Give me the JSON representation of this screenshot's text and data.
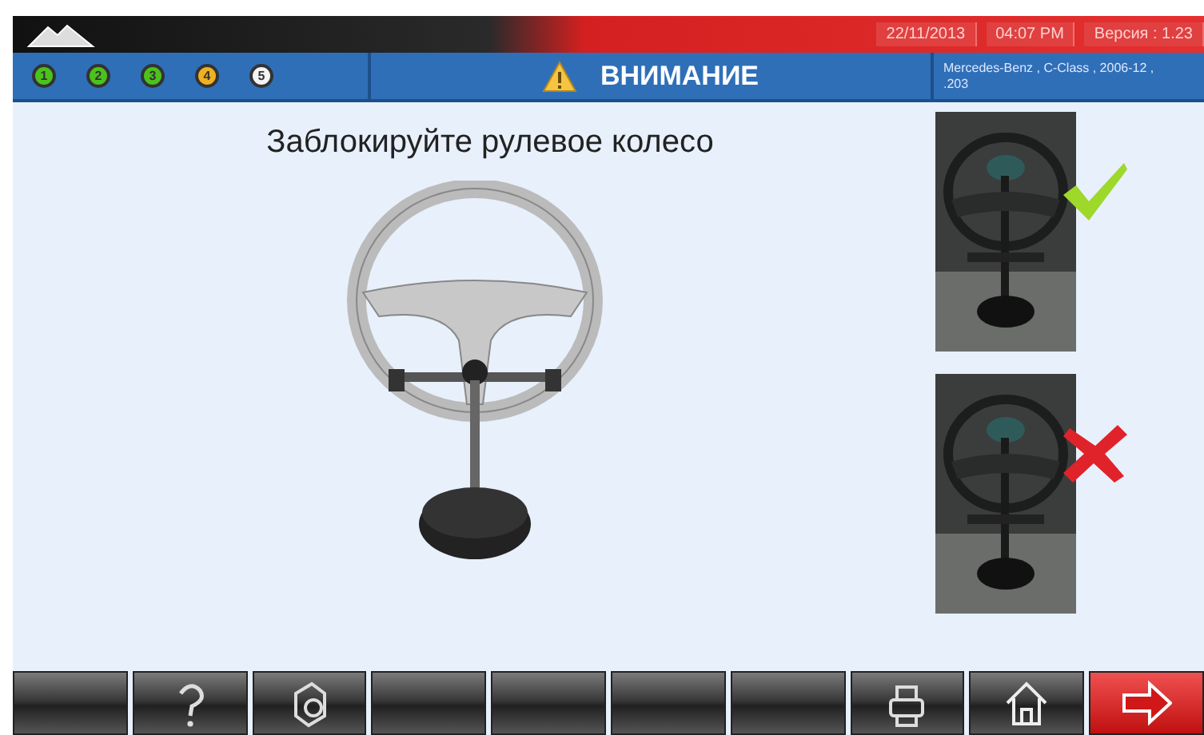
{
  "header": {
    "date": "22/11/2013",
    "time": "04:07 PM",
    "version": "Версия : 1.23"
  },
  "steps": [
    {
      "label": "1",
      "color": "#4cc21c"
    },
    {
      "label": "2",
      "color": "#4cc21c"
    },
    {
      "label": "3",
      "color": "#4cc21c"
    },
    {
      "label": "4",
      "color": "#f0b020"
    },
    {
      "label": "5",
      "color": "#f4f4f4"
    }
  ],
  "alert": {
    "title": "ВНИМАНИЕ"
  },
  "vehicle": {
    "line_1": "Mercedes-Benz , C-Class , 2006-12 ,",
    "line_2": ".203"
  },
  "instruction": "Заблокируйте рулевое колесо",
  "examples": [
    {
      "kind": "correct"
    },
    {
      "kind": "wrong"
    }
  ],
  "toolbar": [
    {
      "kind": "blank"
    },
    {
      "kind": "help"
    },
    {
      "kind": "tool"
    },
    {
      "kind": "blank"
    },
    {
      "kind": "blank"
    },
    {
      "kind": "blank"
    },
    {
      "kind": "blank"
    },
    {
      "kind": "printer"
    },
    {
      "kind": "home"
    },
    {
      "kind": "next"
    }
  ]
}
